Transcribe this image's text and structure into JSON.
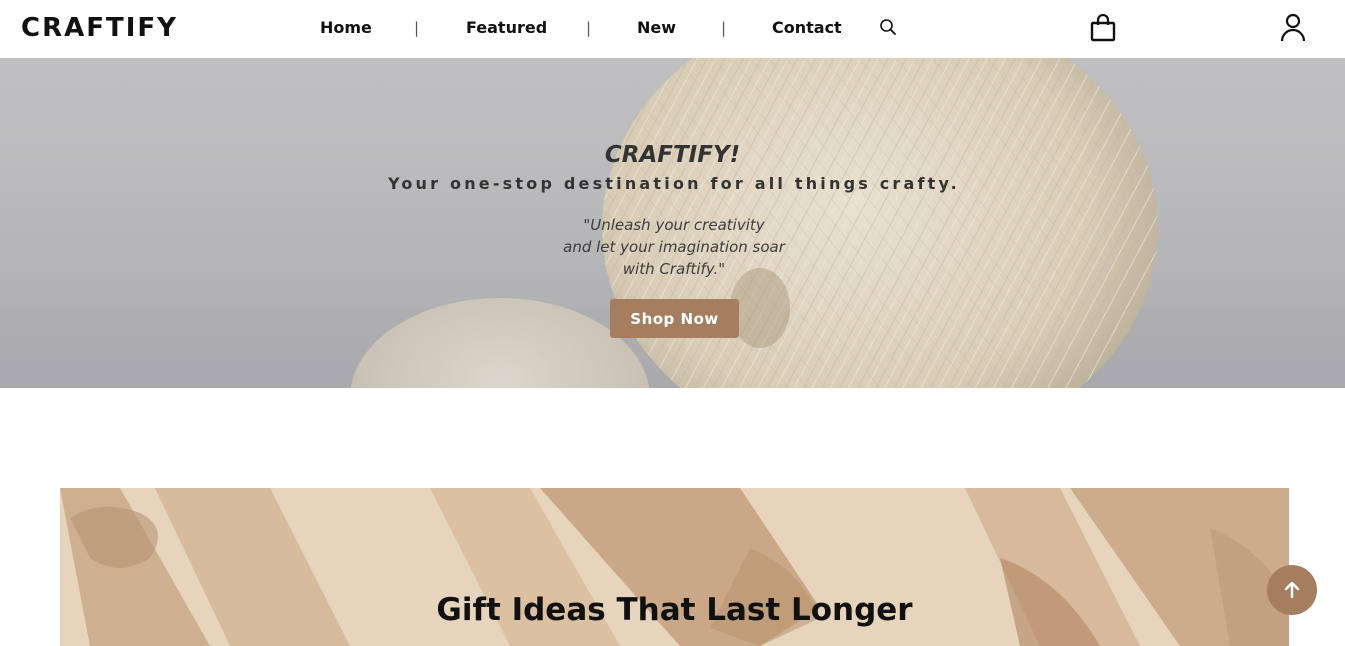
{
  "brand": {
    "name": "CRAFTIFY"
  },
  "nav": {
    "items": [
      {
        "label": "Home"
      },
      {
        "label": "Featured"
      },
      {
        "label": "New"
      },
      {
        "label": "Contact"
      }
    ],
    "separator": "|",
    "search_icon": "search-icon",
    "cart_icon": "shopping-bag-icon",
    "account_icon": "user-icon"
  },
  "hero": {
    "title": "CRAFTIFY!",
    "subtitle": "Your one-stop destination for all things crafty.",
    "quote_lines": [
      "\"Unleash your creativity",
      "and let your imagination soar",
      "with Craftify.\""
    ],
    "cta_label": "Shop Now"
  },
  "gift": {
    "title": "Gift Ideas That Last Longer"
  },
  "scroll_top": {
    "icon": "arrow-up-icon"
  },
  "colors": {
    "accent": "#a57e60",
    "hero_bg": "#bdbdc0",
    "gift_bg": "#e6d4bc",
    "text": "#111111"
  }
}
